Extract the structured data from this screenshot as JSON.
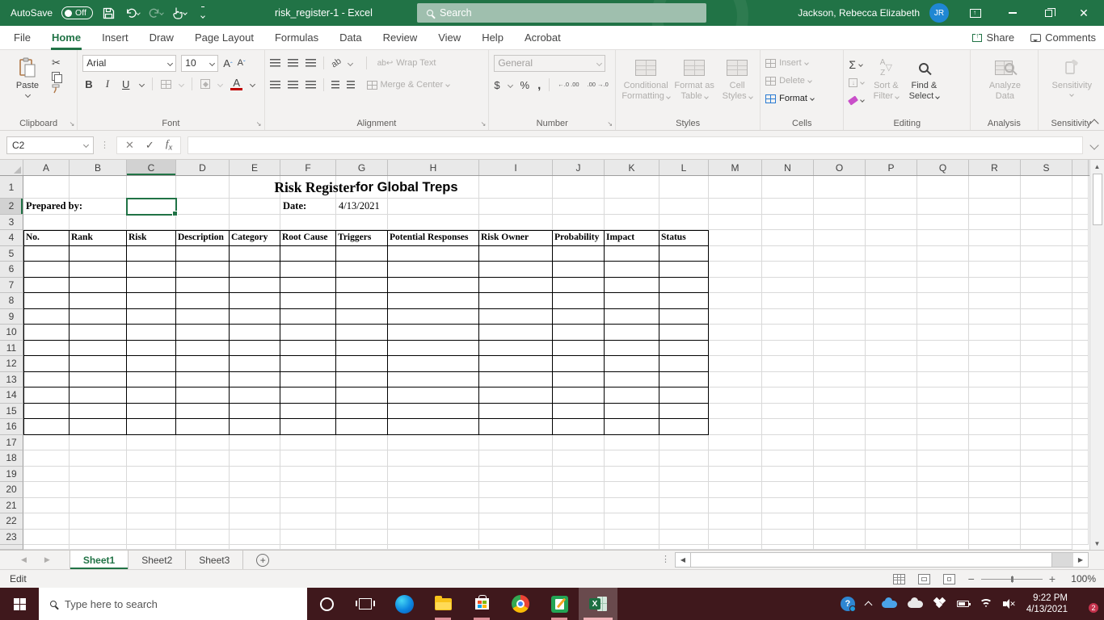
{
  "titlebar": {
    "autosave_label": "AutoSave",
    "autosave_state": "Off",
    "document_title": "risk_register-1 - Excel",
    "search_placeholder": "Search",
    "user_name": "Jackson, Rebecca Elizabeth",
    "user_initials": "JR"
  },
  "ribbon_tabs": {
    "items": [
      {
        "label": "File",
        "active": false
      },
      {
        "label": "Home",
        "active": true
      },
      {
        "label": "Insert",
        "active": false
      },
      {
        "label": "Draw",
        "active": false
      },
      {
        "label": "Page Layout",
        "active": false
      },
      {
        "label": "Formulas",
        "active": false
      },
      {
        "label": "Data",
        "active": false
      },
      {
        "label": "Review",
        "active": false
      },
      {
        "label": "View",
        "active": false
      },
      {
        "label": "Help",
        "active": false
      },
      {
        "label": "Acrobat",
        "active": false
      }
    ],
    "share_label": "Share",
    "comments_label": "Comments"
  },
  "ribbon": {
    "clipboard": {
      "group_label": "Clipboard",
      "paste_label": "Paste"
    },
    "font": {
      "group_label": "Font",
      "font_name": "Arial",
      "font_size": "10",
      "bold": "B",
      "italic": "I",
      "underline": "U"
    },
    "alignment": {
      "group_label": "Alignment",
      "wrap_text_label": "Wrap Text",
      "merge_center_label": "Merge & Center",
      "orientation_glyph": "ab"
    },
    "number": {
      "group_label": "Number",
      "number_format": "General",
      "currency_glyph": "$",
      "percent_glyph": "%",
      "comma_glyph": ",",
      "inc_decimal": "←.0 .00",
      "dec_decimal": ".00 →.0"
    },
    "styles": {
      "group_label": "Styles",
      "conditional_line1": "Conditional",
      "conditional_line2": "Formatting",
      "format_table_line1": "Format as",
      "format_table_line2": "Table",
      "cell_styles_line1": "Cell",
      "cell_styles_line2": "Styles"
    },
    "cells": {
      "group_label": "Cells",
      "insert_label": "Insert",
      "delete_label": "Delete",
      "format_label": "Format"
    },
    "editing": {
      "group_label": "Editing",
      "autosum_glyph": "Σ",
      "sort_filter_line1": "Sort &",
      "sort_filter_line2": "Filter",
      "find_select_line1": "Find &",
      "find_select_line2": "Select"
    },
    "analysis": {
      "group_label": "Analysis",
      "analyze_line1": "Analyze",
      "analyze_line2": "Data"
    },
    "sensitivity": {
      "group_label": "Sensitivity",
      "sensitivity_label": "Sensitivity"
    }
  },
  "formula_bar": {
    "name_box": "C2",
    "formula_value": ""
  },
  "grid": {
    "column_letters": [
      "A",
      "B",
      "C",
      "D",
      "E",
      "F",
      "G",
      "H",
      "I",
      "J",
      "K",
      "L",
      "M",
      "N",
      "O",
      "P",
      "Q",
      "R",
      "S"
    ],
    "row_count": 23,
    "active_cell": {
      "column": "C",
      "row": 2
    },
    "title_serif": "Risk Register ",
    "title_sans": "for Global Treps",
    "cells": {
      "A2": {
        "text": "Prepared by:",
        "bold": true
      },
      "F2": {
        "text": "Date:",
        "bold": true
      },
      "G2": {
        "text": "4/13/2021",
        "bold": false
      }
    },
    "table_header_row": 4,
    "table_last_row": 16,
    "table_first_col_index": 0,
    "table_last_col_index": 11,
    "table_headers": [
      "No.",
      "Rank",
      "Risk",
      "Description",
      "Category",
      "Root Cause",
      "Triggers",
      "Potential Responses",
      "Risk Owner",
      "Probability",
      "Impact",
      "Status"
    ]
  },
  "sheet_bar": {
    "tabs": [
      {
        "label": "Sheet1",
        "active": true
      },
      {
        "label": "Sheet2",
        "active": false
      },
      {
        "label": "Sheet3",
        "active": false
      }
    ]
  },
  "status_bar": {
    "mode": "Edit",
    "zoom_level": "100%"
  },
  "taskbar": {
    "search_placeholder": "Type here to search",
    "time": "9:22 PM",
    "date": "4/13/2021",
    "notification_badge": "2"
  },
  "colors": {
    "excel_green": "#217346",
    "titlebar_search_pill": "#9fbfae",
    "taskbar_maroon": "#3f181c",
    "avatar_blue": "#1f87d3",
    "font_color_red": "#c00000",
    "active_cell_border": "#217346"
  }
}
